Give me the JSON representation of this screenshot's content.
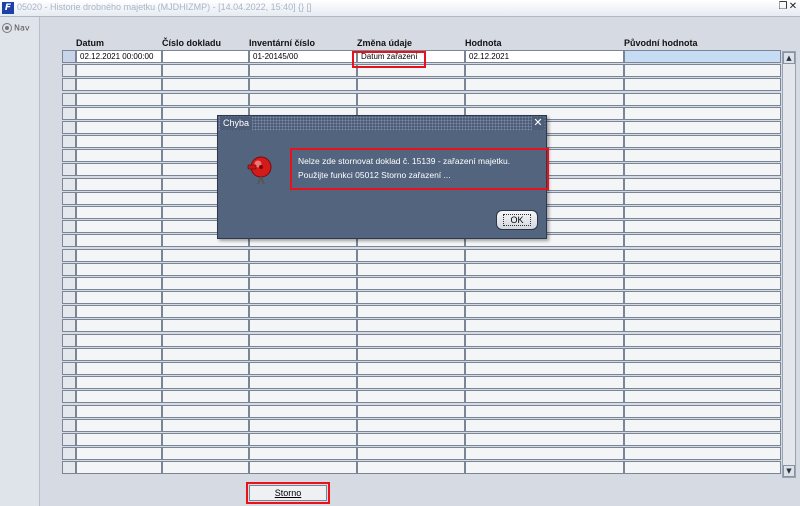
{
  "window": {
    "title": "05020 - Historie drobného majetku (MJDHIZMP) - [14.04.2022, 15:40] {} []",
    "app_icon": "F",
    "controls": [
      "restore-icon",
      "close-icon"
    ]
  },
  "nav": {
    "tab_label": "Nav"
  },
  "table": {
    "columns": [
      "Datum",
      "Číslo dokladu",
      "Inventární číslo",
      "Změna údaje",
      "Hodnota",
      "Původní hodnota"
    ],
    "rows": [
      [
        "02.12.2021 00:00:00",
        "",
        "01-20145/00",
        "Datum zařazení",
        "02.12.2021",
        ""
      ]
    ],
    "empty_rows": 29
  },
  "buttons": {
    "storno": "Storno"
  },
  "dialog": {
    "title": "Chyba",
    "close_glyph": "✕",
    "message_line1": "Nelze zde stornovat doklad č. 15139 - zařazení majetku.",
    "message_line2": "Použijte funkci 05012 Storno zařazení ...",
    "ok_label": "OK",
    "icon": "alarm-bell-icon"
  },
  "colors": {
    "highlight": "#e8121b",
    "dialog_bg": "#52647e",
    "selected_row": "#c6dcf5"
  }
}
